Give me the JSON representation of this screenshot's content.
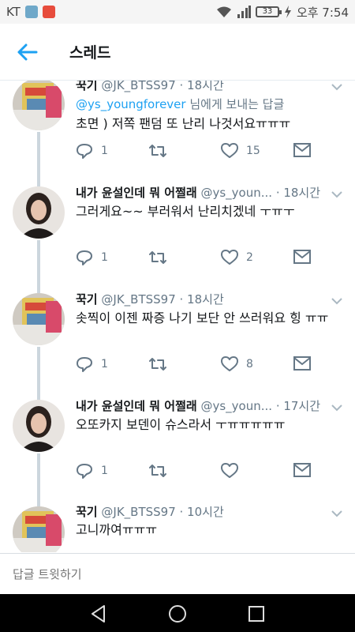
{
  "status_bar": {
    "carrier": "KT",
    "battery": "33",
    "time": "오후 7:54",
    "icons": [
      "gallery-icon",
      "app-icon",
      "wifi-icon",
      "signal-icon",
      "battery-icon",
      "charging-icon"
    ]
  },
  "header": {
    "back_icon": "arrow-left-icon",
    "title": "스레드"
  },
  "colors": {
    "accent": "#1da1f2",
    "secondary_text": "#657786",
    "thread_line": "#ccd6dd"
  },
  "tweets": [
    {
      "name": "꾹기",
      "handle": "@JK_BTSS97",
      "time": "· 18시간",
      "reply_to": {
        "mention": "@ys_youngforever",
        "suffix": " 님에게 보내는 답글"
      },
      "text": "초면 ) 저쪽 팬덤 또 난리 나것서요ㅠㅠㅠ",
      "reply_count": "1",
      "like_count": "15"
    },
    {
      "name": "내가 윤설인데 뭐 어쩔래",
      "handle": "@ys_youn...",
      "time": "· 18시간",
      "text": "그러게요~~ 부러워서 난리치겠네 ㅜㅠㅜ",
      "reply_count": "1",
      "like_count": "2"
    },
    {
      "name": "꾹기",
      "handle": "@JK_BTSS97",
      "time": "· 18시간",
      "text": "솟찍이 이젠 짜증 나기 보단 안 쓰러워요 힝 ㅠㅠ",
      "reply_count": "1",
      "like_count": "8"
    },
    {
      "name": "내가 윤설인데 뭐 어쩔래",
      "handle": "@ys_youn...",
      "time": "· 17시간",
      "text": "오또카지 보덴이 슈스라서 ㅜㅠㅠㅠㅠㅠ",
      "reply_count": "1",
      "like_count": ""
    },
    {
      "name": "꾹기",
      "handle": "@JK_BTSS97",
      "time": "· 10시간",
      "text": "고니까여ㅠㅠㅠ",
      "reply_count": "",
      "like_count": ""
    }
  ],
  "compose": {
    "placeholder": "답글 트윗하기"
  },
  "nav": {
    "icons": [
      "back-triangle-icon",
      "home-circle-icon",
      "recents-square-icon"
    ]
  }
}
